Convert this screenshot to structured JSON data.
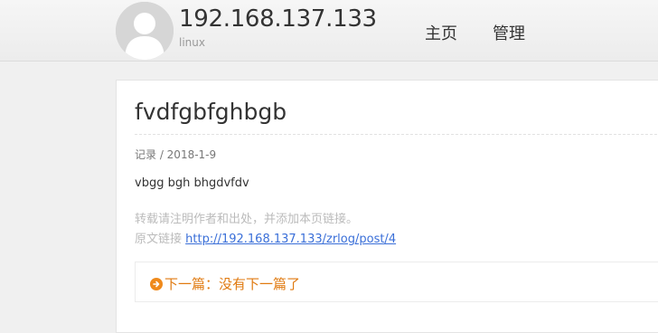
{
  "header": {
    "site_title": "192.168.137.133",
    "site_subtitle": "linux",
    "nav": {
      "home": "主页",
      "admin": "管理"
    }
  },
  "post": {
    "title": "fvdfgbfghbgb",
    "meta": "记录 / 2018-1-9",
    "body": "vbgg bgh bhgdvfdv",
    "copyright_notice": "转载请注明作者和出处，并添加本页链接。",
    "source_label": "原文链接 ",
    "source_url": "http://192.168.137.133/zrlog/post/4",
    "next_label": "下一篇：没有下一篇了"
  },
  "colors": {
    "next_accent": "#e07a10",
    "link": "#3a6fd8"
  }
}
